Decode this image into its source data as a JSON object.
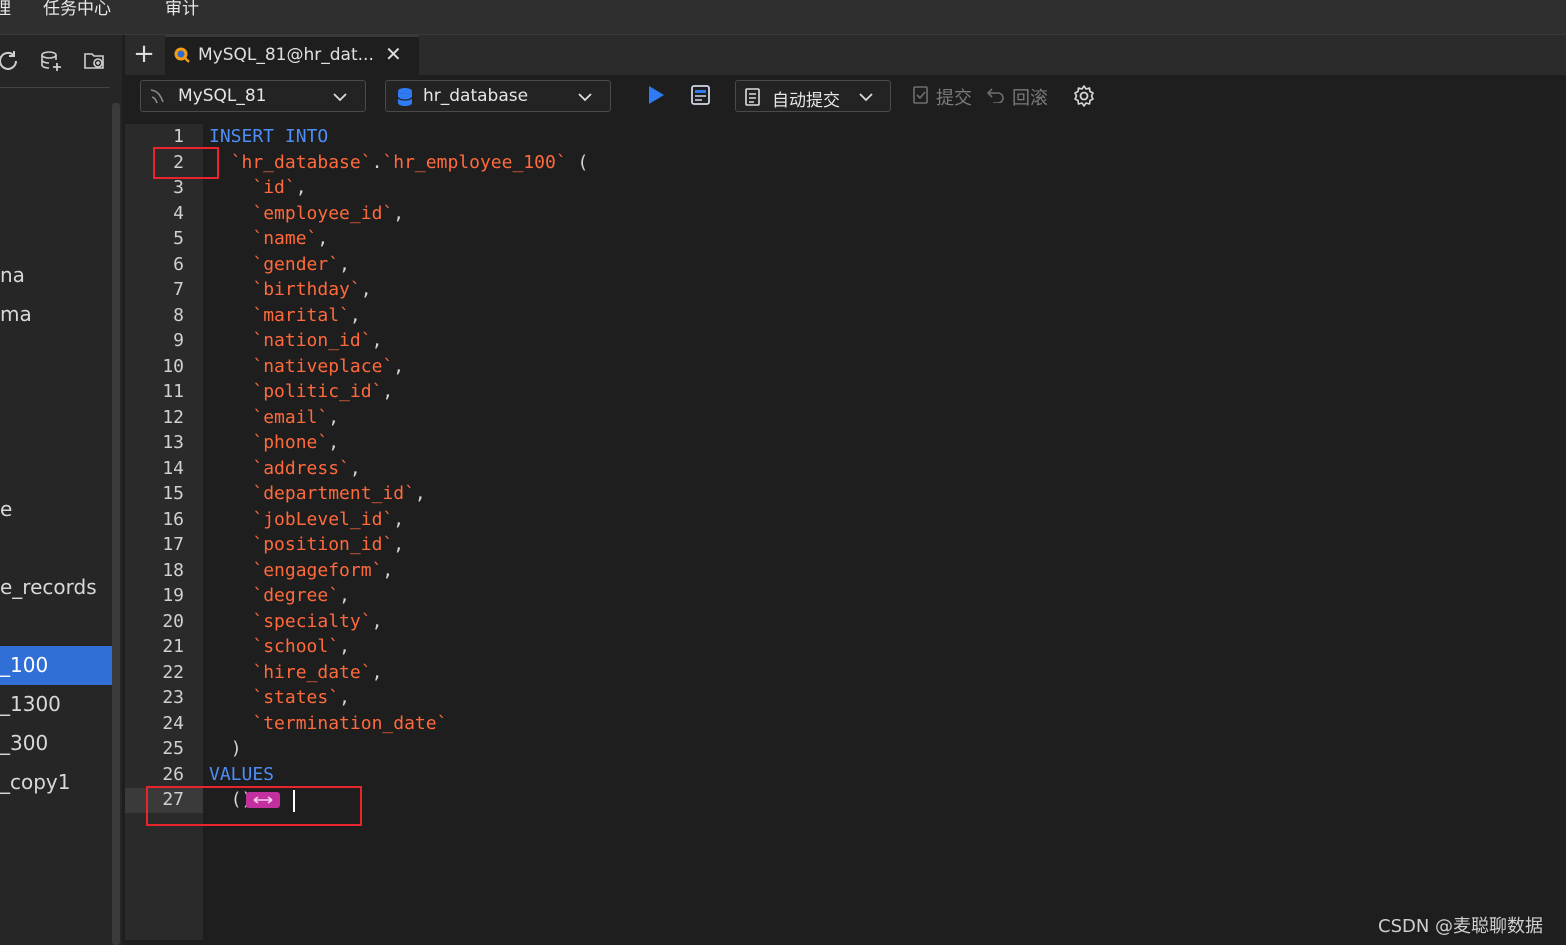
{
  "menu": {
    "items": [
      "理",
      "任务中心",
      "审计"
    ]
  },
  "sidebar": {
    "items": [
      {
        "label": "na",
        "selected": false
      },
      {
        "label": "ma",
        "selected": false
      },
      {
        "label": "e",
        "selected": false
      },
      {
        "label": "e_records",
        "selected": false
      },
      {
        "label": "_100",
        "selected": true
      },
      {
        "label": "_1300",
        "selected": false
      },
      {
        "label": "_300",
        "selected": false
      },
      {
        "label": "_copy1",
        "selected": false
      }
    ]
  },
  "tabs": {
    "add_label": "+",
    "active_title": "MySQL_81@hr_dat...",
    "close_label": "✕"
  },
  "toolbar": {
    "connection": "MySQL_81",
    "database": "hr_database",
    "autocommit": "自动提交",
    "commit": "提交",
    "rollback": "回滚"
  },
  "editor": {
    "current_line": 27,
    "lines": [
      "INSERT INTO",
      "  `hr_database`.`hr_employee_100` (",
      "    `id`,",
      "    `employee_id`,",
      "    `name`,",
      "    `gender`,",
      "    `birthday`,",
      "    `marital`,",
      "    `nation_id`,",
      "    `nativeplace`,",
      "    `politic_id`,",
      "    `email`,",
      "    `phone`,",
      "    `address`,",
      "    `department_id`,",
      "    `jobLevel_id`,",
      "    `position_id`,",
      "    `engageform`,",
      "    `degree`,",
      "    `specialty`,",
      "    `school`,",
      "    `hire_date`,",
      "    `states`,",
      "    `termination_date`",
      "  )",
      "VALUES",
      "  ()"
    ]
  },
  "watermark": "CSDN @麦聪聊数据",
  "colors": {
    "keyword": "#4e8ef7",
    "identifier": "#ff6a3d",
    "selection": "#2f6fd6",
    "annotation": "#e8252b"
  }
}
